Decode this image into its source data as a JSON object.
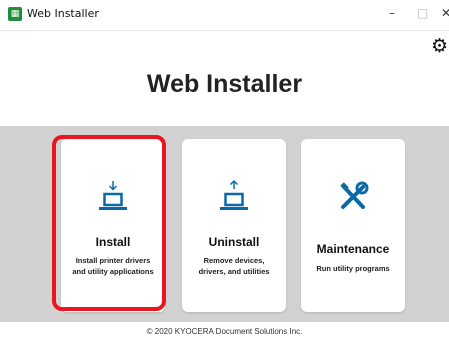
{
  "window": {
    "title": "Web Installer",
    "app_icon_letter": "▦",
    "minimize": "–",
    "maximize": "□",
    "close": "✕"
  },
  "header": {
    "title": "Web Installer",
    "settings_icon": "gear-icon",
    "settings_glyph": "⚙"
  },
  "cards": [
    {
      "title": "Install",
      "desc_line1": "Install printer drivers",
      "desc_line2": "and utility applications",
      "icon": "download-laptop-icon",
      "selected": true
    },
    {
      "title": "Uninstall",
      "desc_line1": "Remove devices,",
      "desc_line2": "drivers, and utilities",
      "icon": "upload-laptop-icon",
      "selected": false
    },
    {
      "title": "Maintenance",
      "desc_line1": "Run utility programs",
      "desc_line2": "",
      "icon": "tools-icon",
      "selected": false
    }
  ],
  "footer": {
    "copyright": "© 2020 KYOCERA Document Solutions Inc."
  },
  "colors": {
    "accent": "#0a6aa8",
    "highlight": "#e8161f",
    "background": "#d2d2d2"
  }
}
